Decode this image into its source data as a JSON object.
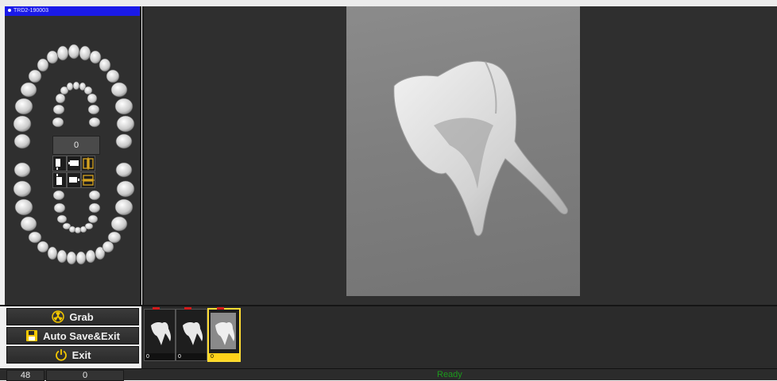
{
  "patient": {
    "id": "TRD2-190003"
  },
  "arch_panel": {
    "selected_count": "0",
    "rotation_buttons": [
      "rotate-vertical-icon",
      "rotate-horizontal-icon",
      "flip-vertical-icon",
      "flip-horizontal-icon"
    ]
  },
  "buttons": {
    "grab": "Grab",
    "auto_save_exit": "Auto Save&Exit",
    "exit": "Exit"
  },
  "thumbnails": [
    {
      "index": "0",
      "selected": false
    },
    {
      "index": "0",
      "selected": false
    },
    {
      "index": "0",
      "selected": true
    }
  ],
  "status": {
    "cell1": "48",
    "cell2": "0",
    "message": "Ready",
    "message_color": "#1c9a1c"
  },
  "colors": {
    "patient_bar": "#1a1ae8",
    "accent_icon": "#f5c800",
    "selected_thumb": "#ffdd33",
    "tag_red": "#d21b1b"
  }
}
